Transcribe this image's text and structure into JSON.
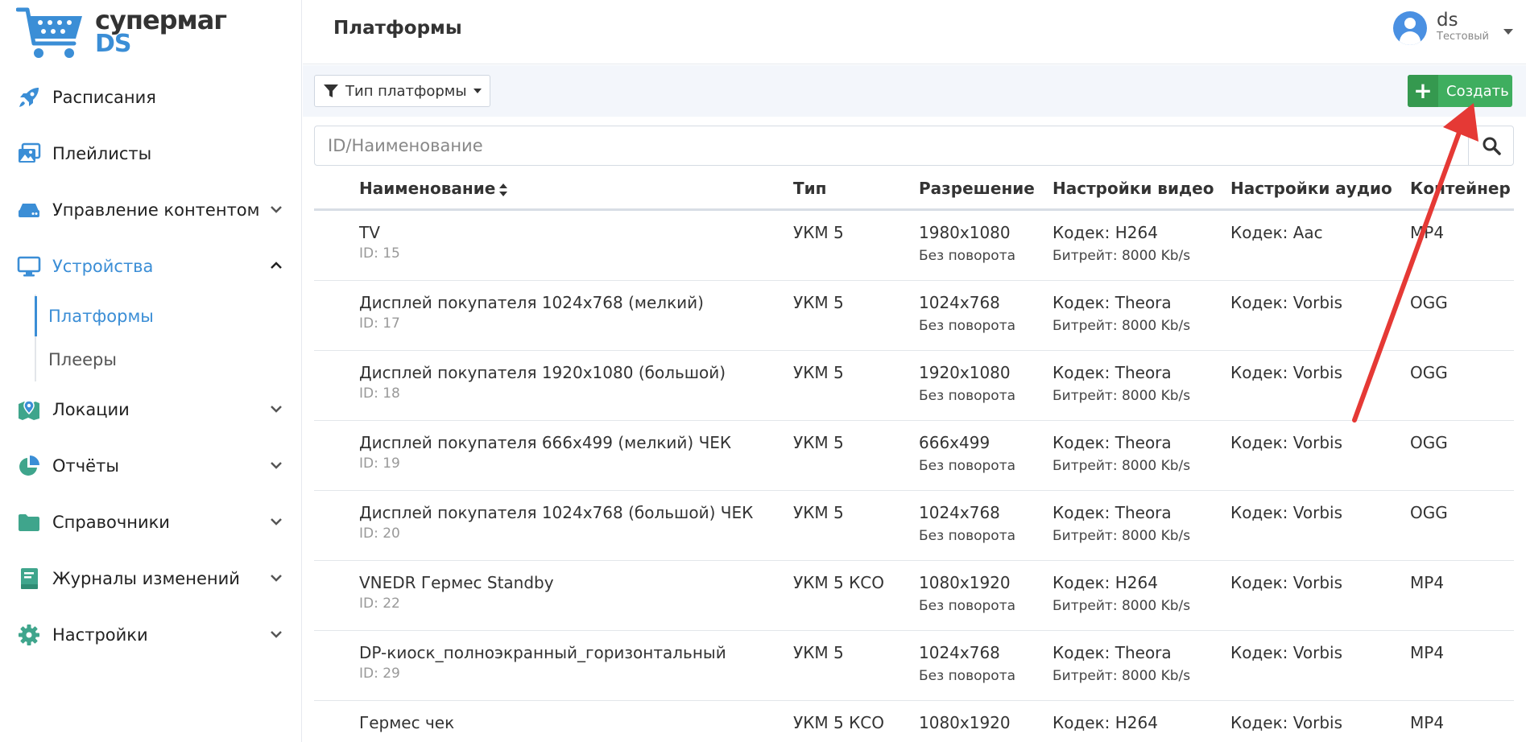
{
  "app": {
    "logo_line1": "супермаг",
    "logo_line2": "DS"
  },
  "sidebar": {
    "items": [
      {
        "label": "Расписания",
        "icon": "rocket-icon"
      },
      {
        "label": "Плейлисты",
        "icon": "images-icon"
      },
      {
        "label": "Управление контентом",
        "icon": "hdd-icon"
      },
      {
        "label": "Устройства",
        "icon": "monitor-icon"
      },
      {
        "label": "Локации",
        "icon": "map-icon"
      },
      {
        "label": "Отчёты",
        "icon": "pie-chart-icon"
      },
      {
        "label": "Справочники",
        "icon": "folder-icon"
      },
      {
        "label": "Журналы изменений",
        "icon": "book-icon"
      },
      {
        "label": "Настройки",
        "icon": "gear-icon"
      }
    ],
    "sub_items": [
      {
        "label": "Платформы",
        "active": true
      },
      {
        "label": "Плееры",
        "active": false
      }
    ]
  },
  "header": {
    "title": "Платформы",
    "user_name": "ds",
    "user_role": "Тестовый"
  },
  "toolbar": {
    "filter_label": "Тип платформы",
    "create_label": "Создать"
  },
  "search": {
    "placeholder": "ID/Наименование"
  },
  "table": {
    "columns": [
      "Наименование",
      "Тип",
      "Разрешение",
      "Настройки видео",
      "Настройки аудио",
      "Контейнер"
    ],
    "rows": [
      {
        "name": "TV",
        "id": "ID: 15",
        "type": "УКМ 5",
        "res": "1980x1080",
        "rot": "Без поворота",
        "vcodec": "Кодек: H264",
        "bitrate": "Битрейт: 8000 Kb/s",
        "acodec": "Кодек: Aac",
        "container": "MP4"
      },
      {
        "name": "Дисплей покупателя 1024x768 (мелкий)",
        "id": "ID: 17",
        "type": "УКМ 5",
        "res": "1024x768",
        "rot": "Без поворота",
        "vcodec": "Кодек: Theora",
        "bitrate": "Битрейт: 8000 Kb/s",
        "acodec": "Кодек: Vorbis",
        "container": "OGG"
      },
      {
        "name": "Дисплей покупателя 1920x1080 (большой)",
        "id": "ID: 18",
        "type": "УКМ 5",
        "res": "1920x1080",
        "rot": "Без поворота",
        "vcodec": "Кодек: Theora",
        "bitrate": "Битрейт: 8000 Kb/s",
        "acodec": "Кодек: Vorbis",
        "container": "OGG"
      },
      {
        "name": "Дисплей покупателя 666x499 (мелкий) ЧЕК",
        "id": "ID: 19",
        "type": "УКМ 5",
        "res": "666x499",
        "rot": "Без поворота",
        "vcodec": "Кодек: Theora",
        "bitrate": "Битрейт: 8000 Kb/s",
        "acodec": "Кодек: Vorbis",
        "container": "OGG"
      },
      {
        "name": "Дисплей покупателя 1024x768 (большой) ЧЕК",
        "id": "ID: 20",
        "type": "УКМ 5",
        "res": "1024x768",
        "rot": "Без поворота",
        "vcodec": "Кодек: Theora",
        "bitrate": "Битрейт: 8000 Kb/s",
        "acodec": "Кодек: Vorbis",
        "container": "OGG"
      },
      {
        "name": "VNEDR Гермес Standby",
        "id": "ID: 22",
        "type": "УКМ 5 КСО",
        "res": "1080x1920",
        "rot": "Без поворота",
        "vcodec": "Кодек: H264",
        "bitrate": "Битрейт: 8000 Kb/s",
        "acodec": "Кодек: Vorbis",
        "container": "MP4"
      },
      {
        "name": "DP-киоск_полноэкранный_горизонтальный",
        "id": "ID: 29",
        "type": "УКМ 5",
        "res": "1024x768",
        "rot": "Без поворота",
        "vcodec": "Кодек: Theora",
        "bitrate": "Битрейт: 8000 Kb/s",
        "acodec": "Кодек: Vorbis",
        "container": "MP4"
      },
      {
        "name": "Гермес чек",
        "id": "",
        "type": "УКМ 5 КСО",
        "res": "1080x1920",
        "rot": "",
        "vcodec": "Кодек: H264",
        "bitrate": "",
        "acodec": "Кодек: Vorbis",
        "container": "MP4"
      }
    ]
  },
  "colors": {
    "accent": "#3b8ed6",
    "sidebar_icon": "#3fa58c",
    "create_button": "#3fae5f",
    "annotation_arrow": "#e53935"
  }
}
